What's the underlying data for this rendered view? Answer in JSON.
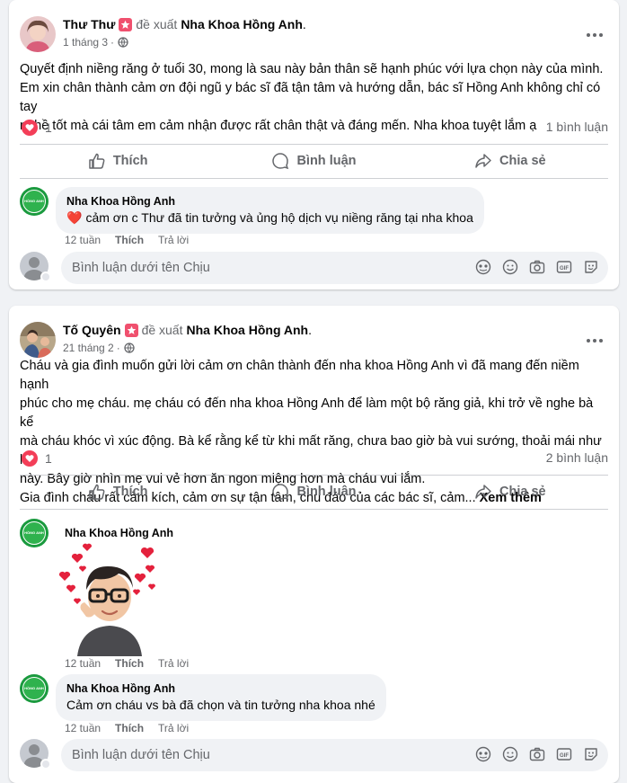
{
  "posts": [
    {
      "author": "Thư Thư",
      "suggest_text": "đề xuất",
      "page": "Nha Khoa Hồng Anh",
      "time": "1 tháng 3",
      "body_lines": [
        "Quyết định niềng răng ở tuổi 30, mong là sau này bản thân sẽ hạnh phúc với lựa chọn này của mình.",
        "Em xin chân thành cảm ơn đội ngũ y bác sĩ đã tận tâm và hướng dẫn, bác sĩ Hồng Anh không chỉ có tay",
        "nghề tốt mà cái tâm em cảm nhận được rất chân thật và đáng mến. Nha khoa tuyệt lắm ạ"
      ],
      "reaction_count": "1",
      "comment_count": "1 bình luận",
      "actions": {
        "like": "Thích",
        "comment": "Bình luận",
        "share": "Chia sẻ"
      },
      "comments": [
        {
          "name": "Nha Khoa Hồng Anh",
          "text": "cảm ơn c Thư đã tin tưởng và ủng hộ dịch vụ niềng răng tại nha khoa",
          "time": "12 tuần",
          "like": "Thích",
          "reply": "Trả lời"
        }
      ],
      "compose_placeholder": "Bình luận dưới tên Chịu"
    },
    {
      "author": "Tố Quyên",
      "suggest_text": "đề xuất",
      "page": "Nha Khoa Hồng Anh",
      "time": "21 tháng 2",
      "body_lines": [
        "Cháu và gia đình muốn gửi lời cảm ơn chân thành đến nha khoa Hồng Anh vì đã mang đến niềm hạnh",
        "phúc cho mẹ cháu.  mẹ cháu có đến nha khoa Hồng Anh để làm một bộ răng giả, khi trở về nghe bà kể",
        "mà cháu khóc vì xúc động. Bà kể rằng kể từ khi mất răng, chưa bao giờ bà vui sướng, thoải mái như lúc",
        "này. Bây giờ nhìn mẹ vui vẻ hơn  ăn ngon miệng hơn mà cháu vui lắm.",
        "Gia đình cháu rất cảm kích, cảm ơn sự tận tâm, chu đáo của các bác sĩ, cảm..."
      ],
      "see_more": "Xem thêm",
      "reaction_count": "1",
      "comment_count": "2 bình luận",
      "actions": {
        "like": "Thích",
        "comment": "Bình luận",
        "share": "Chia sẻ"
      },
      "comments": [
        {
          "name": "Nha Khoa Hồng Anh",
          "text": "",
          "time": "12 tuần",
          "like": "Thích",
          "reply": "Trả lời"
        },
        {
          "name": "Nha Khoa Hồng Anh",
          "text": "Cảm ơn cháu vs bà đã chọn và tin tưởng nha khoa nhé",
          "time": "12 tuần",
          "like": "Thích",
          "reply": "Trả lời"
        }
      ],
      "compose_placeholder": "Bình luận dưới tên Chịu"
    }
  ],
  "logo_text": "HỒNG ANH",
  "colors": {
    "like_heart": "#f33e58",
    "brand_green": "#1a9a3e",
    "secondary_text": "#65676b"
  }
}
